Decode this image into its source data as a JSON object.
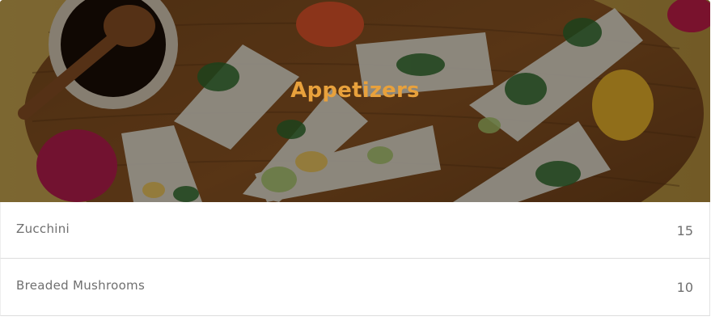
{
  "section": {
    "title": "Appetizers",
    "title_color": "#e8a13c",
    "hero_image": "spring-rolls-on-wooden-board-photo"
  },
  "items": [
    {
      "name": "Zucchini",
      "price": "15"
    },
    {
      "name": "Breaded Mushrooms",
      "price": "10"
    }
  ]
}
